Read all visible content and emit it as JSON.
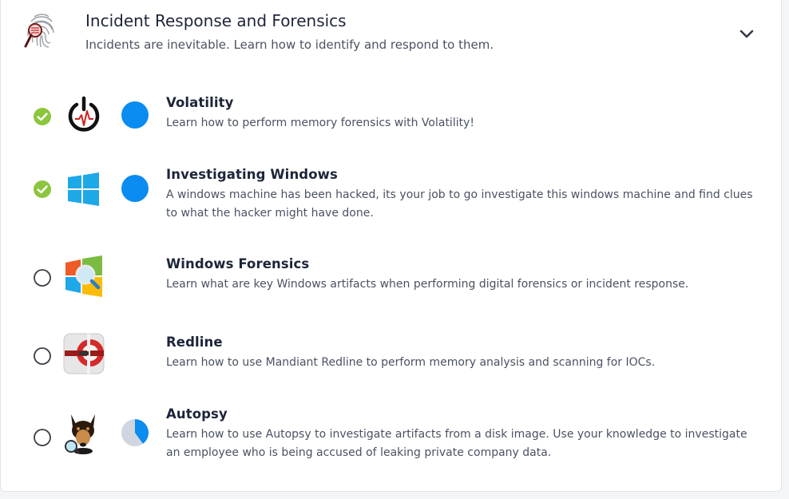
{
  "module": {
    "title": "Incident Response and Forensics",
    "subtitle": "Incidents are inevitable. Learn how to identify and respond to them.",
    "icon": "fingerprint-magnifier-icon",
    "expand_icon": "chevron-down-icon"
  },
  "colors": {
    "complete_green": "#8cc63f",
    "progress_blue": "#0a8cf0",
    "progress_track": "#cfd6df",
    "title_text": "#1c2538",
    "body_text": "#4a5262"
  },
  "rooms": [
    {
      "title": "Volatility",
      "description": "Learn how to perform memory forensics with Volatility!",
      "completed": true,
      "progress": 1.0,
      "logo": "volatility-power-icon"
    },
    {
      "title": "Investigating Windows",
      "description": "A windows machine has been hacked, its your job to go investigate this windows machine and find clues to what the hacker might have done.",
      "completed": true,
      "progress": 1.0,
      "logo": "windows-logo-icon"
    },
    {
      "title": "Windows Forensics",
      "description": "Learn what are key Windows artifacts when performing digital forensics or incident response.",
      "completed": false,
      "progress": null,
      "logo": "windows-magnifier-icon"
    },
    {
      "title": "Redline",
      "description": "Learn how to use Mandiant Redline to perform memory analysis and scanning for IOCs.",
      "completed": false,
      "progress": null,
      "logo": "redline-logo-icon"
    },
    {
      "title": "Autopsy",
      "description": "Learn how to use Autopsy to investigate artifacts from a disk image. Use your knowledge to investigate an employee who is being accused of leaking private company data.",
      "completed": false,
      "progress": 0.4,
      "logo": "autopsy-dog-icon"
    }
  ]
}
